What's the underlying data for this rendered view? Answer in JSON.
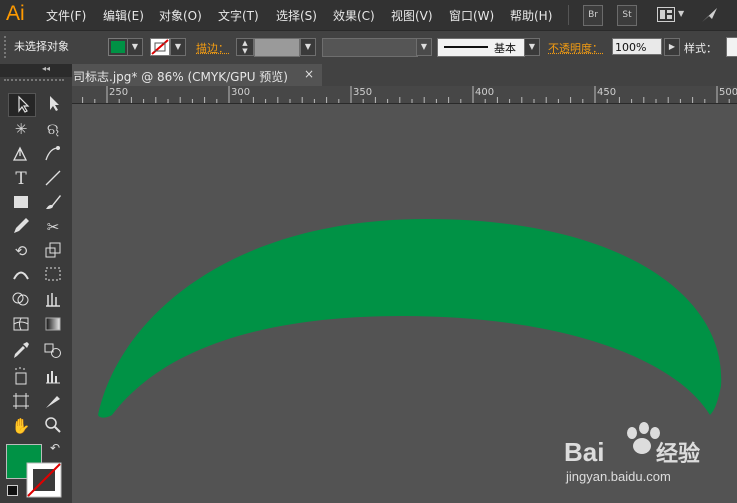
{
  "app": {
    "logo": "Ai"
  },
  "menu": [
    "文件(F)",
    "编辑(E)",
    "对象(O)",
    "文字(T)",
    "选择(S)",
    "效果(C)",
    "视图(V)",
    "窗口(W)",
    "帮助(H)"
  ],
  "menu_buttons": {
    "bridge": "Br",
    "stock": "St"
  },
  "control_bar": {
    "selection_status": "未选择对象",
    "fill_color": "#009245",
    "stroke_label": "描边：",
    "brush_label": "基本",
    "opacity_label": "不透明度：",
    "opacity_value": "100%",
    "style_label": "样式："
  },
  "document_tab": {
    "title": "司标志.jpg* @ 86% (CMYK/GPU 预览)",
    "close": "×"
  },
  "ruler": {
    "labels": [
      "250",
      "300",
      "350",
      "400",
      "450",
      "500"
    ]
  },
  "toolbar": {
    "collapse": "◂◂",
    "swap": "↶"
  },
  "colors": {
    "accent_green": "#009245",
    "ui_dark": "#323232",
    "canvas_gray": "#535353",
    "menu_orange": "#ff9a00"
  },
  "watermark": {
    "text": "Baidu 经验",
    "url": "jingyan.baidu.com"
  }
}
